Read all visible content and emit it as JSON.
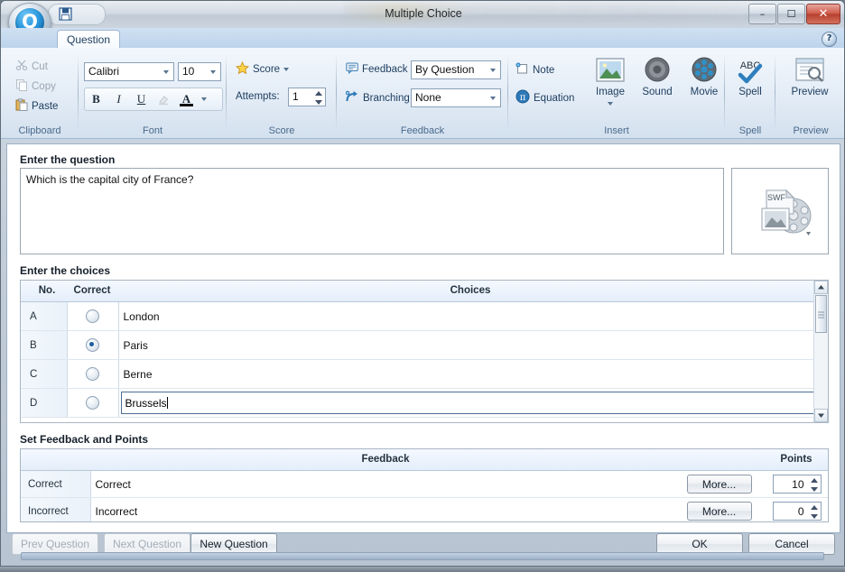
{
  "window": {
    "title": "Multiple Choice",
    "app_icon": "q-logo-icon",
    "quick_access": {
      "save": "save-icon"
    },
    "controls": {
      "minimize": "–",
      "maximize": "❐",
      "close": "✕"
    }
  },
  "ribbon": {
    "tab": "Question",
    "help": "?",
    "groups": {
      "clipboard": {
        "label": "Clipboard",
        "items": [
          {
            "label": "Cut",
            "icon": "scissors-icon",
            "disabled": true
          },
          {
            "label": "Copy",
            "icon": "copy-icon",
            "disabled": true
          },
          {
            "label": "Paste",
            "icon": "paste-icon",
            "disabled": false
          }
        ]
      },
      "font": {
        "label": "Font",
        "family": "Calibri",
        "size": "10",
        "bold": "B",
        "italic": "I",
        "underline": "U",
        "highlight": "highlight-icon",
        "fontcolor": "A"
      },
      "score": {
        "label": "Score",
        "score_button": "Score",
        "attempts_label": "Attempts:",
        "attempts_value": "1"
      },
      "feedback": {
        "label": "Feedback",
        "feedback_label": "Feedback",
        "feedback_value": "By Question",
        "branching_label": "Branching",
        "branching_value": "None"
      },
      "insert": {
        "label": "Insert",
        "note": "Note",
        "equation": "Equation",
        "image": "Image",
        "sound": "Sound",
        "movie": "Movie"
      },
      "spell": {
        "label": "Spell",
        "button": "Spell",
        "glyph": "ABC"
      },
      "preview": {
        "label": "Preview",
        "button": "Preview"
      }
    }
  },
  "main": {
    "question_section_label": "Enter the question",
    "question_text": "Which is the capital city of France?",
    "media_placeholder": "media-swf-image-movie-icon",
    "choices_section_label": "Enter the choices",
    "choices_headers": [
      "No.",
      "Correct",
      "Choices"
    ],
    "choices": [
      {
        "no": "A",
        "correct": false,
        "text": "London",
        "editing": false
      },
      {
        "no": "B",
        "correct": true,
        "text": "Paris",
        "editing": false
      },
      {
        "no": "C",
        "correct": false,
        "text": "Berne",
        "editing": false
      },
      {
        "no": "D",
        "correct": false,
        "text": "Brussels",
        "editing": true
      }
    ],
    "feedback_section_label": "Set Feedback and Points",
    "feedback_headers": [
      "",
      "Feedback",
      "",
      "Points"
    ],
    "feedback_rows": [
      {
        "type": "Correct",
        "feedback": "Correct",
        "more": "More...",
        "points": "10"
      },
      {
        "type": "Incorrect",
        "feedback": "Incorrect",
        "more": "More...",
        "points": "0"
      }
    ]
  },
  "footer": {
    "prev_question": "Prev Question",
    "next_question": "Next Question",
    "new_question": "New Question",
    "ok": "OK",
    "cancel": "Cancel"
  },
  "colors": {
    "accent": "#1a5f9e",
    "ribbon_text": "#1c3c5e",
    "close_button": "#b63f2e"
  }
}
